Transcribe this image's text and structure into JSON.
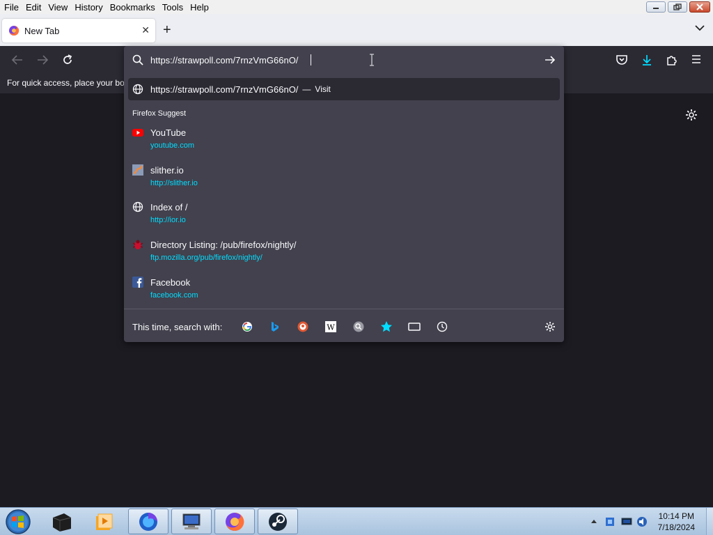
{
  "menu": {
    "file": "File",
    "edit": "Edit",
    "view": "View",
    "history": "History",
    "bookmarks": "Bookmarks",
    "tools": "Tools",
    "help": "Help"
  },
  "tab": {
    "label": "New Tab",
    "close": "✕",
    "new_tab": "+"
  },
  "bookmarks_bar": {
    "text": "For quick access, place your boo"
  },
  "urlbar": {
    "value": "https://strawpoll.com/7rnzVmG66nO/",
    "visit_url": "https://strawpoll.com/7rnzVmG66nO/",
    "visit_separator": "—",
    "visit_label": "Visit"
  },
  "suggest": {
    "heading": "Firefox Suggest",
    "items": [
      {
        "title": "YouTube",
        "url": "youtube.com",
        "icon": "youtube-icon"
      },
      {
        "title": "slither.io",
        "url": "http://slither.io",
        "icon": "slither-icon"
      },
      {
        "title": "Index of /",
        "url": "http://ior.io",
        "icon": "globe-icon"
      },
      {
        "title": "Directory Listing: /pub/firefox/nightly/",
        "url": "ftp.mozilla.org/pub/firefox/nightly/",
        "icon": "bug-icon"
      },
      {
        "title": "Facebook",
        "url": "facebook.com",
        "icon": "facebook-icon"
      }
    ]
  },
  "footer": {
    "search_with": "This time, search with:",
    "engines": [
      "google",
      "bing",
      "duckduckgo",
      "wikipedia",
      "search",
      "bookmarks",
      "tabs",
      "history"
    ]
  },
  "taskbar": {
    "time": "10:14 PM",
    "date": "7/18/2024"
  },
  "colors": {
    "panel_bg": "#42414d",
    "toolbar_bg": "#2b2a33",
    "content_bg": "#1c1b22",
    "link_cyan": "#00ddff",
    "text_light": "#fbfbfe"
  }
}
